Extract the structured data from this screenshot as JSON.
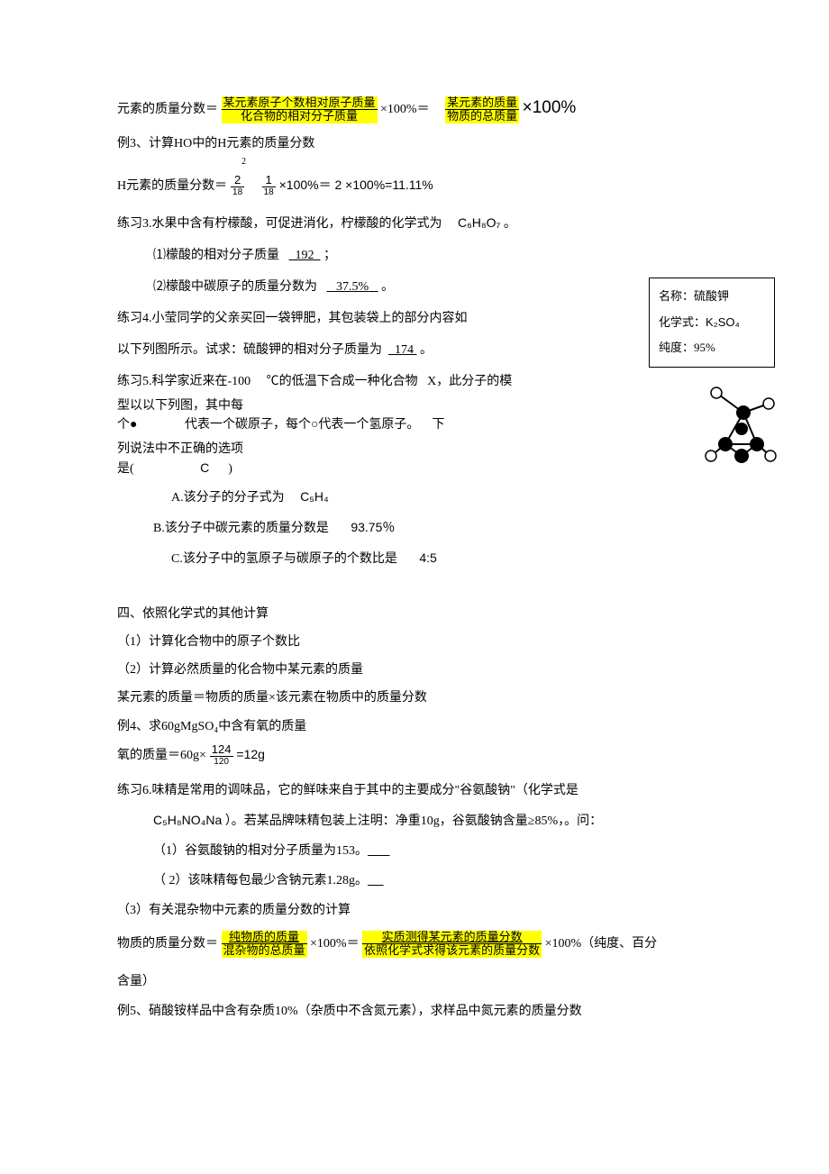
{
  "eq1": {
    "lhs": "元素的质量分数＝",
    "num1": "某元素原子个数相对原子质量",
    "den1": "化合物的相对分子质量",
    "mid": "×100%＝",
    "num2": "某元素的质量",
    "den2": "物质的总质量",
    "tail": "×100%"
  },
  "ex3": {
    "title": "例3、计算HO中的H元素的质量分数",
    "sub": "2",
    "l1a": "H元素的质量分数＝",
    "n1": "2",
    "d1": "18",
    "m1": "1",
    "dd1": "18",
    "txt1": "×100%＝",
    "n2": "2",
    "txt2": "×100%=11.11%"
  },
  "p3": {
    "head": "练习3.水果中含有柠檬酸，可促进消化，柠檬酸的化学式为",
    "formula": "C₆H₈O₇",
    "tail": "。",
    "q1": "⑴檬酸的相对分子质量",
    "a1": "192",
    "a1t": "；",
    "q2": "⑵檬酸中碳原子的质量分数为",
    "a2": "37.5%",
    "a2t": "。"
  },
  "p4": {
    "l1": "练习4.小莹同学的父亲买回一袋钾肥，其包装袋上的部分内容如",
    "l2": "以下列图所示。试求：硫酸钾的相对分子质量为",
    "a": "174",
    "at": "。"
  },
  "box": {
    "l1": "名称：硫酸钾",
    "l2a": "化学式：",
    "l2b": "K₂SO₄",
    "l3": "纯度：95%"
  },
  "p5": {
    "l1": "练习5.科学家近来在-100",
    "l1b": "℃的低温下合成一种化合物",
    "l1c": "X，此分子的模",
    "l2": "型以以下列图，其中每",
    "l2b": "个●",
    "l2c": "代表一个碳原子，每个○代表一个氢原子。",
    "l2d": "下",
    "l3": "列说法中不正确的选项",
    "l3b": "是(",
    "l3c": "C",
    "l3d": ")",
    "a": "A.该分子的分子式为",
    "af": "C₅H₄",
    "b": "B.该分子中碳元素的质量分数是",
    "bv": "93.75％",
    "c": "C.该分子中的氢原子与碳原子的个数比是",
    "cv": "4:5"
  },
  "s4": {
    "h": "四、依照化学式的其他计算",
    "i1": "（1）计算化合物中的原子个数比",
    "i2": "（2）计算必然质量的化合物中某元素的质量",
    "f": "某元素的质量＝物质的质量×该元素在物质中的质量分数",
    "ex4": "例4、求60gMgSO₄中含有氧的质量",
    "ex4a": "氧的质量＝60g×",
    "ex4n": "124",
    "ex4d": "120",
    "ex4t": "=12g"
  },
  "p6": {
    "l1": "练习6.味精是常用的调味品，它的鲜味来自于其中的主要成分\"谷氨酸钠\"（化学式是",
    "l2a": "C₅H₈NO₄Na",
    "l2b": "）。若某品牌味精包装上注明：净重10g，谷氨酸钠含量≥85%，。问：",
    "q1": "（1）谷氨酸钠的相对分子质量为153。",
    "q2": "（ 2）该味精每包最少含钠元素1.28g。"
  },
  "s3i3": "（3）有关混杂物中元素的质量分数的计算",
  "eq2": {
    "lhs": "物质的质量分数＝",
    "n1": "纯物质的质量",
    "d1": "混杂物的总质量",
    "m": "×100%＝",
    "n2": "实质测得某元素的质量分数",
    "d2": "依照化学式求得该元素的质量分数",
    "t": "×100%（纯度、百分",
    "t2": "含量）"
  },
  "ex5": "例5、硝酸铵样品中含有杂质10%（杂质中不含氮元素），求样品中氮元素的质量分数"
}
